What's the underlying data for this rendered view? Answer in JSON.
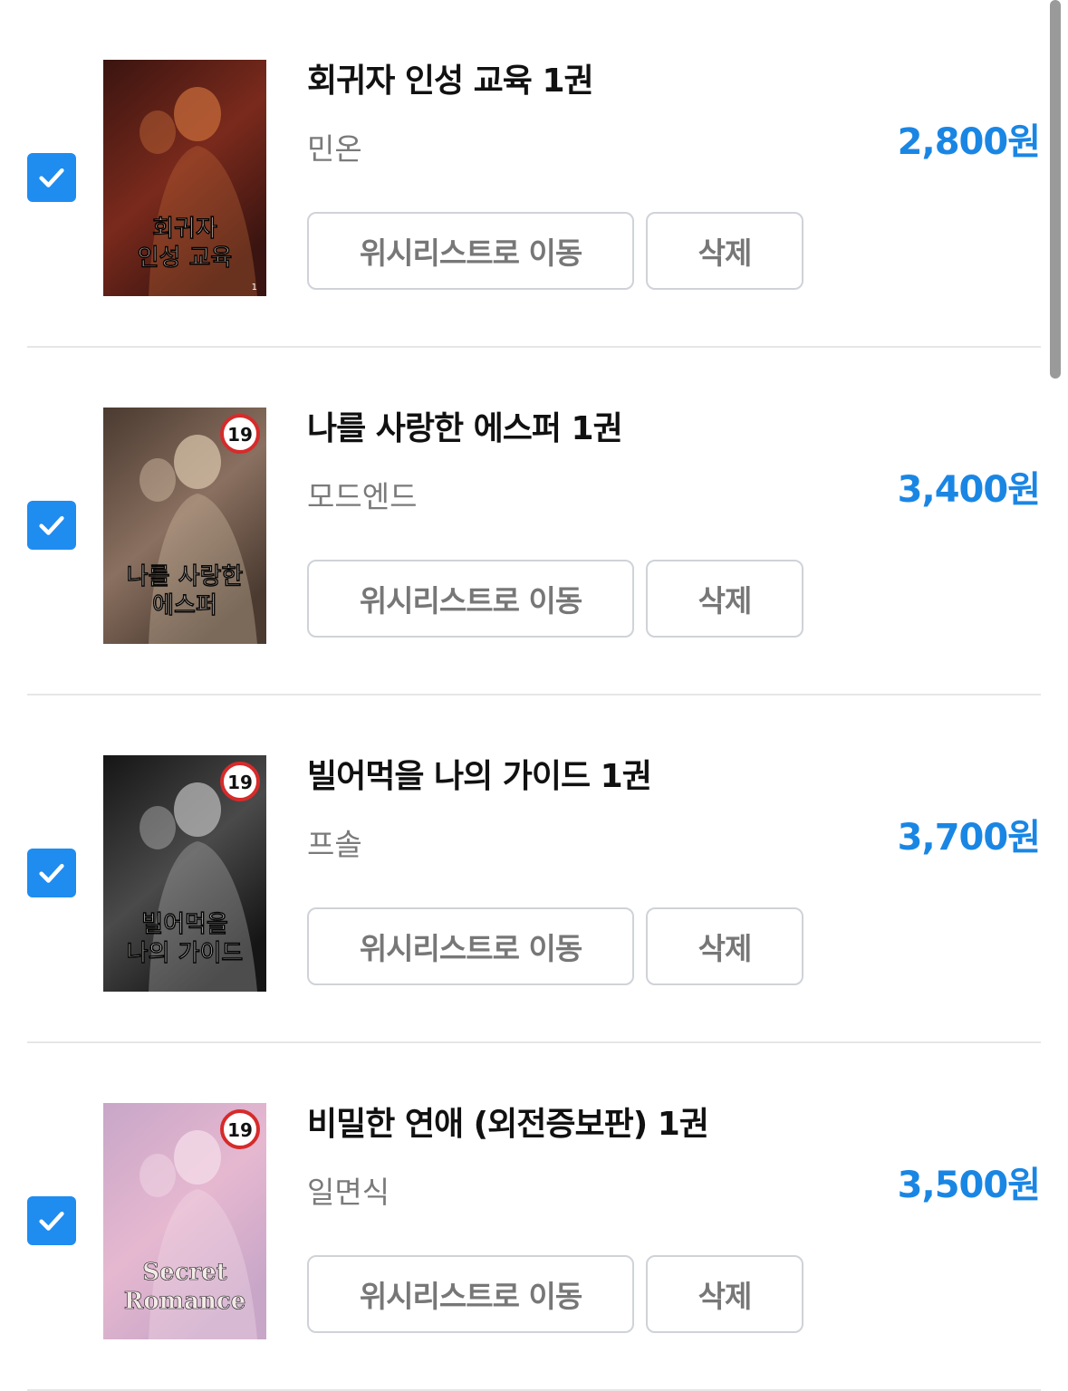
{
  "cart": {
    "items": [
      {
        "title": "회귀자 인성 교육 1권",
        "author": "민온",
        "price": "2,800원",
        "checked": true,
        "adult": false,
        "wishlist_label": "위시리스트로 이동",
        "delete_label": "삭제",
        "cover": {
          "lines": [
            "회귀자",
            "인성 교육"
          ],
          "corner": "1",
          "palette": [
            "#3a1410",
            "#7a2a1c",
            "#c46a3a"
          ]
        }
      },
      {
        "title": "나를 사랑한 에스퍼 1권",
        "author": "모드엔드",
        "price": "3,400원",
        "checked": true,
        "adult": true,
        "age_badge": "19",
        "wishlist_label": "위시리스트로 이동",
        "delete_label": "삭제",
        "cover": {
          "lines": [
            "나를 사랑한",
            "에스퍼"
          ],
          "corner": "",
          "palette": [
            "#4a3a30",
            "#8a7060",
            "#d6c2a8"
          ]
        }
      },
      {
        "title": "빌어먹을 나의 가이드 1권",
        "author": "프솔",
        "price": "3,700원",
        "checked": true,
        "adult": true,
        "age_badge": "19",
        "wishlist_label": "위시리스트로 이동",
        "delete_label": "삭제",
        "cover": {
          "lines": [
            "빌어먹을",
            "나의 가이드"
          ],
          "corner": "",
          "palette": [
            "#151515",
            "#4a4a4a",
            "#b8b8b8"
          ]
        }
      },
      {
        "title": "비밀한 연애 (외전증보판) 1권",
        "author": "일면식",
        "price": "3,500원",
        "checked": true,
        "adult": true,
        "age_badge": "19",
        "wishlist_label": "위시리스트로 이동",
        "delete_label": "삭제",
        "cover": {
          "lines": [
            "Secret",
            "Romance"
          ],
          "corner": "",
          "palette": [
            "#c8a6c8",
            "#e6b8d0",
            "#f4dce8"
          ]
        }
      }
    ]
  },
  "icons": {
    "checkbox": "check-icon",
    "age_badge": "age-19-badge-icon"
  },
  "colors": {
    "accent": "#1f8cf0",
    "price": "#1a86e4",
    "divider": "#e6e6e6",
    "button_border": "#cfd3d8"
  }
}
